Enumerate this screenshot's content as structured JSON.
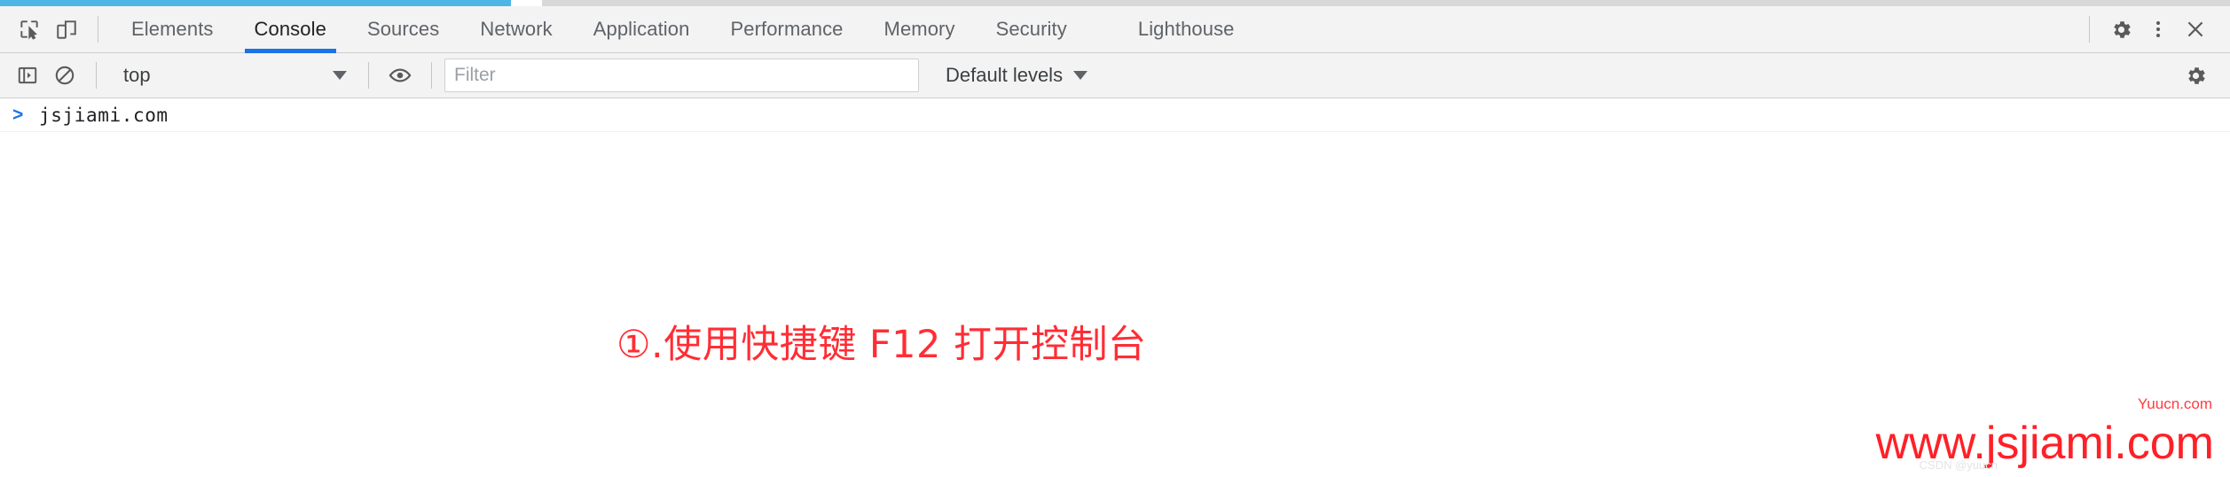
{
  "window": {
    "accent_blue": "#1a73e8",
    "progress_blue": "#4eb5e5",
    "annotation_red": "#ff2d35"
  },
  "tabbar": {
    "left_icons": [
      {
        "name": "inspect-element-icon",
        "title": "Inspect element"
      },
      {
        "name": "device-toolbar-icon",
        "title": "Toggle device toolbar"
      }
    ],
    "tabs": [
      {
        "label": "Elements",
        "active": false
      },
      {
        "label": "Console",
        "active": true
      },
      {
        "label": "Sources",
        "active": false
      },
      {
        "label": "Network",
        "active": false
      },
      {
        "label": "Application",
        "active": false
      },
      {
        "label": "Performance",
        "active": false
      },
      {
        "label": "Memory",
        "active": false
      },
      {
        "label": "Security",
        "active": false
      },
      {
        "label": "Lighthouse",
        "active": false
      }
    ],
    "right_icons": [
      {
        "name": "gear-icon",
        "title": "Settings"
      },
      {
        "name": "more-vertical-icon",
        "title": "Customize and control DevTools"
      },
      {
        "name": "close-icon",
        "title": "Close DevTools"
      }
    ]
  },
  "console_toolbar": {
    "sidebar_toggle": "console-sidebar-icon",
    "clear_console": "clear-console-icon",
    "context": {
      "value": "top",
      "caret": "chevron-down-icon"
    },
    "live_expression": "eye-icon",
    "filter": {
      "value": "",
      "placeholder": "Filter"
    },
    "levels": {
      "value": "Default levels",
      "caret": "chevron-down-icon"
    },
    "settings": "gear-icon"
  },
  "console_body": {
    "rows": [
      {
        "prompt": ">",
        "text": "jsjiami.com"
      }
    ]
  },
  "annotation": {
    "text": "①.使用快捷键 F12 打开控制台"
  },
  "watermarks": {
    "site": "www.jsjiami.com",
    "source": "Yuucn.com",
    "faint": "CSDN @yuucn"
  }
}
